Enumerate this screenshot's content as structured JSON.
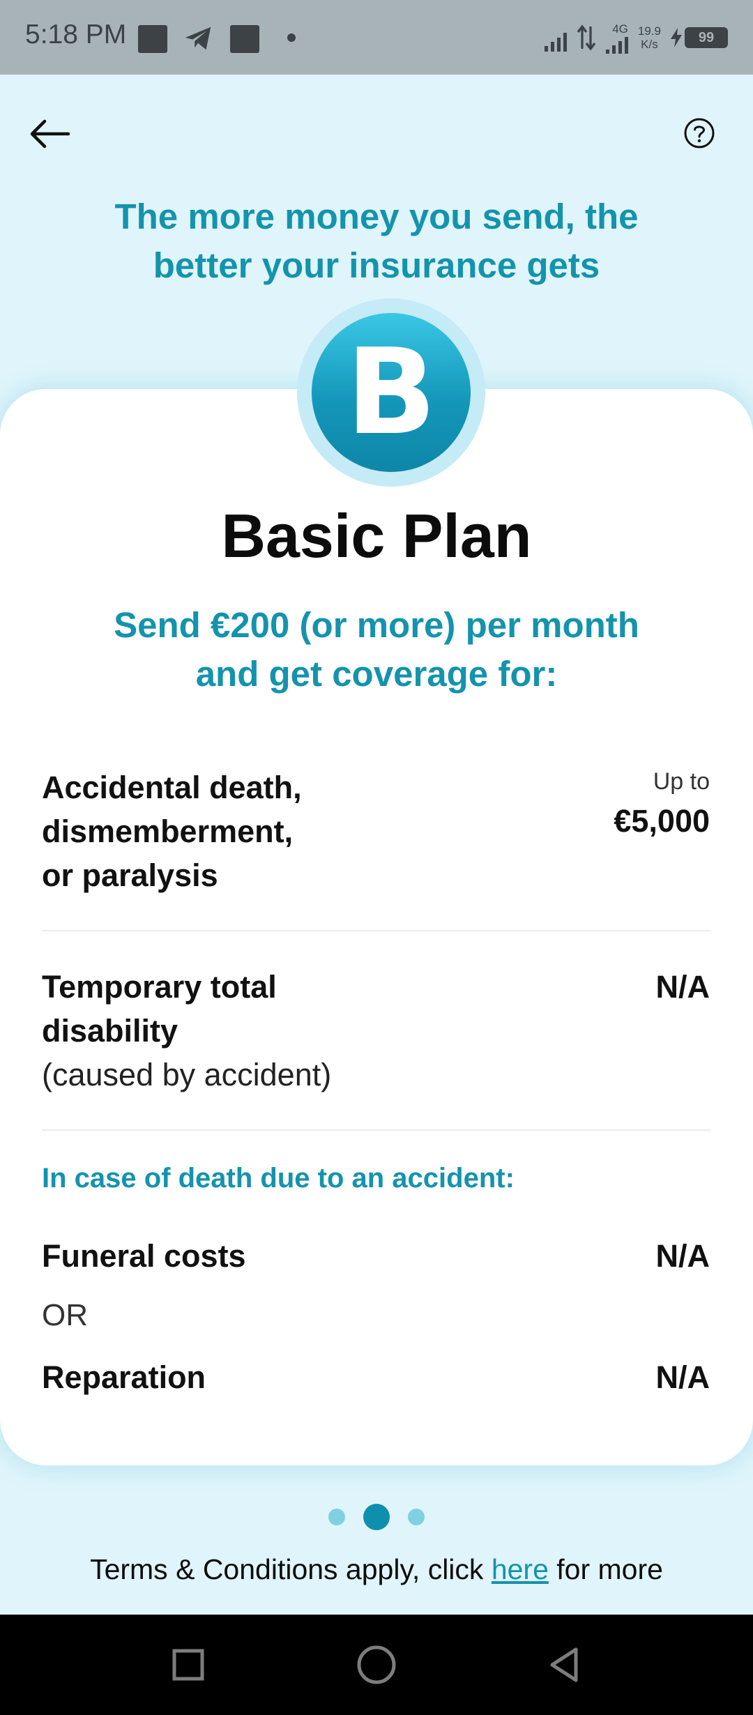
{
  "status_bar": {
    "time": "5:18 PM",
    "network_type": "4G",
    "speed_value": "19.9",
    "speed_unit": "K/s",
    "battery": "99"
  },
  "header": {
    "back_icon": "arrow-left-icon",
    "help_icon": "question-circle-icon",
    "headline": "The more money you send, the better your insurance gets"
  },
  "plan": {
    "badge_letter": "B",
    "title": "Basic Plan",
    "subtitle": "Send €200 (or more) per month and get coverage for:"
  },
  "coverage": {
    "row1": {
      "label_line1": "Accidental death,",
      "label_line2": "dismemberment,",
      "label_line3": "or paralysis",
      "prefix": "Up to",
      "value": "€5,000"
    },
    "row2": {
      "label_line1": "Temporary total",
      "label_line2": "disability",
      "label_note": "(caused by accident)",
      "value": "N/A"
    },
    "section_label": "In case of death due to an accident:",
    "row3": {
      "label": "Funeral costs",
      "value": "N/A"
    },
    "or_text": "OR",
    "row4": {
      "label": "Reparation",
      "value": "N/A"
    }
  },
  "pager": {
    "active_index": 1,
    "count": 3
  },
  "terms": {
    "before": "Terms & Conditions apply, click ",
    "link": "here",
    "after": " for more"
  },
  "colors": {
    "accent": "#1493ad",
    "background": "#e0f5fb",
    "card": "#ffffff"
  }
}
